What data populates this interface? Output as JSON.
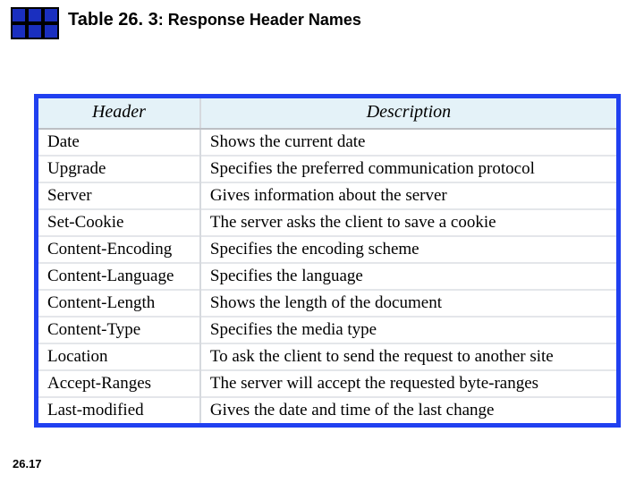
{
  "title": {
    "prefix": "Table 26. 3",
    "sep": ": ",
    "rest": "Response Header Names"
  },
  "page_number": "26.17",
  "columns": {
    "c1": "Header",
    "c2": "Description"
  },
  "rows": [
    {
      "h": "Date",
      "d": "Shows the current date"
    },
    {
      "h": "Upgrade",
      "d": "Specifies the preferred communication protocol"
    },
    {
      "h": "Server",
      "d": "Gives information about the server"
    },
    {
      "h": "Set-Cookie",
      "d": "The server asks the client to save a cookie"
    },
    {
      "h": "Content-Encoding",
      "d": "Specifies the encoding scheme"
    },
    {
      "h": "Content-Language",
      "d": "Specifies the language"
    },
    {
      "h": "Content-Length",
      "d": "Shows the length of the document"
    },
    {
      "h": "Content-Type",
      "d": "Specifies the media type"
    },
    {
      "h": "Location",
      "d": "To ask the client to send the request to another site"
    },
    {
      "h": "Accept-Ranges",
      "d": "The server will accept the requested byte-ranges"
    },
    {
      "h": "Last-modified",
      "d": "Gives the date and time of the last change"
    }
  ]
}
